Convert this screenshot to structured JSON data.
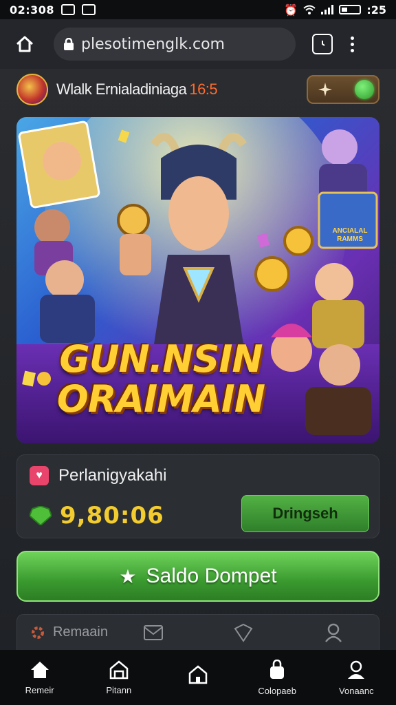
{
  "status_bar": {
    "time": "02:308",
    "battery_time": ":25"
  },
  "browser": {
    "url": "plesotimenglk.com"
  },
  "app": {
    "title": "Wlalk Ernialadiniaga",
    "title_highlight": "16:5"
  },
  "banner": {
    "line1": "GUN.NSIN",
    "line2": "ORAIMAIN",
    "card_text_1": "ANCIALAL",
    "card_text_2": "RAMMS"
  },
  "card": {
    "label": "Perlanigyakahi",
    "amount": "9,80:06",
    "button_label": "Dringseh"
  },
  "main_button": {
    "label": "Saldo Dompet"
  },
  "inner_bar": {
    "first_label": "Remaain"
  },
  "bottom_nav": [
    {
      "label": "Remeir"
    },
    {
      "label": "Pitann"
    },
    {
      "label": ""
    },
    {
      "label": "Colopaeb"
    },
    {
      "label": "Vonaanc"
    }
  ],
  "colors": {
    "accent_green": "#3a9a2f",
    "amount_yellow": "#f3cc2f",
    "highlight_orange": "#ff6a2b"
  }
}
